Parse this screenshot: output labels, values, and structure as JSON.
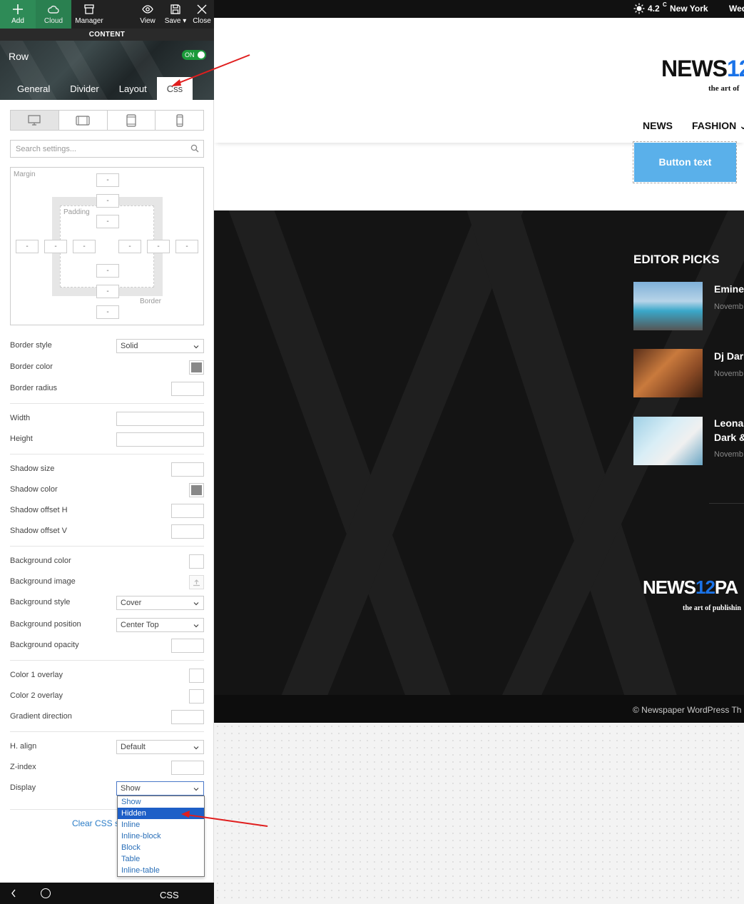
{
  "toolbar": {
    "add": "Add",
    "cloud": "Cloud",
    "manager": "Manager",
    "view": "View",
    "save": "Save",
    "close": "Close"
  },
  "content_label": "CONTENT",
  "row": {
    "title": "Row",
    "toggle": "ON"
  },
  "tabs": [
    "General",
    "Divider",
    "Layout",
    "Css"
  ],
  "search": {
    "placeholder": "Search settings..."
  },
  "box_model": {
    "margin_label": "Margin",
    "padding_label": "Padding",
    "border_label": "Border",
    "placeholder": "-"
  },
  "settings": {
    "border_style": {
      "label": "Border style",
      "value": "Solid"
    },
    "border_color": {
      "label": "Border color",
      "color": "#888888"
    },
    "border_radius": {
      "label": "Border radius"
    },
    "width": {
      "label": "Width"
    },
    "height": {
      "label": "Height"
    },
    "shadow_size": {
      "label": "Shadow size"
    },
    "shadow_color": {
      "label": "Shadow color",
      "color": "#888888"
    },
    "shadow_offset_h": {
      "label": "Shadow offset H"
    },
    "shadow_offset_v": {
      "label": "Shadow offset V"
    },
    "background_color": {
      "label": "Background color"
    },
    "background_image": {
      "label": "Background image"
    },
    "background_style": {
      "label": "Background style",
      "value": "Cover"
    },
    "background_position": {
      "label": "Background position",
      "value": "Center Top"
    },
    "background_opacity": {
      "label": "Background opacity"
    },
    "color1_overlay": {
      "label": "Color 1 overlay"
    },
    "color2_overlay": {
      "label": "Color 2 overlay"
    },
    "gradient_direction": {
      "label": "Gradient direction"
    },
    "h_align": {
      "label": "H. align",
      "value": "Default"
    },
    "z_index": {
      "label": "Z-index"
    },
    "display": {
      "label": "Display",
      "value": "Show"
    }
  },
  "display_options": [
    "Show",
    "Hidden",
    "Inline",
    "Inline-block",
    "Block",
    "Table",
    "Inline-table"
  ],
  "display_highlighted": "Hidden",
  "clear_css": "Clear CSS settings",
  "bottom_bar": {
    "css": "CSS"
  },
  "preview": {
    "weather_temp": "4.2",
    "weather_unit": "C",
    "weather_city": "New York",
    "date": "Wed",
    "logo_word": "NEWS",
    "logo_num": "12",
    "tagline": "the art of",
    "nav": [
      "NEWS",
      "FASHION"
    ],
    "button_text": "Button text",
    "editor_picks": "EDITOR PICKS",
    "picks": [
      {
        "title": "Eminer",
        "date": "Novemb"
      },
      {
        "title": "Dj Dark",
        "date": "Novemb"
      },
      {
        "title": "Leona",
        "title2": "Dark &",
        "date": "Novemb"
      }
    ],
    "logo_bottom_word": "NEWS",
    "logo_bottom_num": "12",
    "logo_bottom_suffix": "PA",
    "tagline_bottom": "the art of publishin",
    "copyright": "© Newspaper WordPress Th"
  },
  "colors": {
    "accent_green": "#2e8b57",
    "toggle_on": "#1b9a3a",
    "button_blue": "#5ab0ea",
    "dropdown_selected": "#1e5fc7"
  }
}
